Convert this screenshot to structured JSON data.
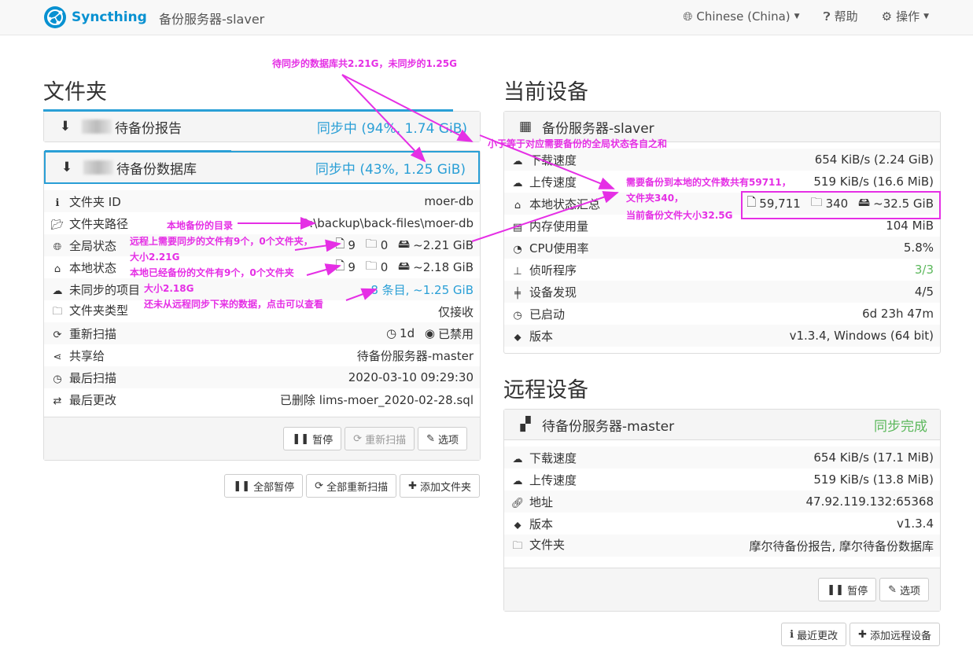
{
  "navbar": {
    "brand": "Syncthing",
    "device_title": "备份服务器-slaver",
    "language": "Chinese (China)",
    "help": "帮助",
    "actions": "操作"
  },
  "folders": {
    "heading": "文件夹",
    "items": [
      {
        "name": "待备份报告",
        "status": "同步中 (94%, 1.74 GiB)",
        "progress": 0.94
      },
      {
        "name": "待备份数据库",
        "status": "同步中 (43%, 1.25 GiB)",
        "progress": 0.43
      }
    ],
    "details": {
      "folder_id_label": "文件夹 ID",
      "folder_id": "moer-db",
      "path_label": "文件夹路径",
      "path": "D:\\backup\\back-files\\moer-db",
      "global_label": "全局状态",
      "global_files": "9",
      "global_dirs": "0",
      "global_size": "~2.21 GiB",
      "local_label": "本地状态",
      "local_files": "9",
      "local_dirs": "0",
      "local_size": "~2.18 GiB",
      "out_of_sync_label": "未同步的项目",
      "out_of_sync": "8 条目, ~1.25 GiB",
      "type_label": "文件夹类型",
      "type": "仅接收",
      "rescan_label": "重新扫描",
      "rescan_interval": "1d",
      "watcher": "已禁用",
      "shared_label": "共享给",
      "shared": "待备份服务器-master",
      "last_scan_label": "最后扫描",
      "last_scan": "2020-03-10 09:29:30",
      "last_change_label": "最后更改",
      "last_change": "已删除 lims-moer_2020-02-28.sql"
    },
    "buttons": {
      "pause": "暂停",
      "rescan": "重新扫描",
      "options": "选项"
    },
    "global_buttons": {
      "pause_all": "全部暂停",
      "rescan_all": "全部重新扫描",
      "add_folder": "添加文件夹"
    }
  },
  "this_device": {
    "heading": "当前设备",
    "name": "备份服务器-slaver",
    "download_label": "下载速度",
    "download": "654 KiB/s (2.24 GiB)",
    "upload_label": "上传速度",
    "upload": "519 KiB/s (16.6 MiB)",
    "local_summary_label": "本地状态汇总",
    "local_files": "59,711",
    "local_dirs": "340",
    "local_size": "~32.5 GiB",
    "ram_label": "内存使用量",
    "ram": "104 MiB",
    "cpu_label": "CPU使用率",
    "cpu": "5.8%",
    "listeners_label": "侦听程序",
    "listeners": "3/3",
    "discovery_label": "设备发现",
    "discovery": "4/5",
    "uptime_label": "已启动",
    "uptime": "6d 23h 47m",
    "version_label": "版本",
    "version": "v1.3.4, Windows (64 bit)"
  },
  "remote_devices": {
    "heading": "远程设备",
    "name": "待备份服务器-master",
    "status": "同步完成",
    "download_label": "下载速度",
    "download": "654 KiB/s (17.1 MiB)",
    "upload_label": "上传速度",
    "upload": "519 KiB/s (13.8 MiB)",
    "address_label": "地址",
    "address": "47.92.119.132:65368",
    "version_label": "版本",
    "version": "v1.3.4",
    "folders_label": "文件夹",
    "folders": "摩尔待备份报告, 摩尔待备份数据库",
    "buttons": {
      "pause": "暂停",
      "options": "选项"
    },
    "global_buttons": {
      "recent_changes": "最近更改",
      "add_device": "添加远程设备"
    }
  },
  "annotations": {
    "a1": "待同步的数据库共2.21G，未同步的1.25G",
    "a2": "小于等于对应需要备份的全局状态各自之和",
    "a3": "需要备份到本地的文件数共有59711，",
    "a4": "文件夹340，",
    "a5": "当前备份文件大小32.5G",
    "a6": "本地备份的目录",
    "a7": "远程上需要同步的文件有9个，0个文件夹，",
    "a8": "大小2.21G",
    "a9": "本地已经备份的文件有9个，0个文件夹",
    "a10": "大小2.18G",
    "a11": "还未从远程同步下来的数据，点击可以查看"
  }
}
